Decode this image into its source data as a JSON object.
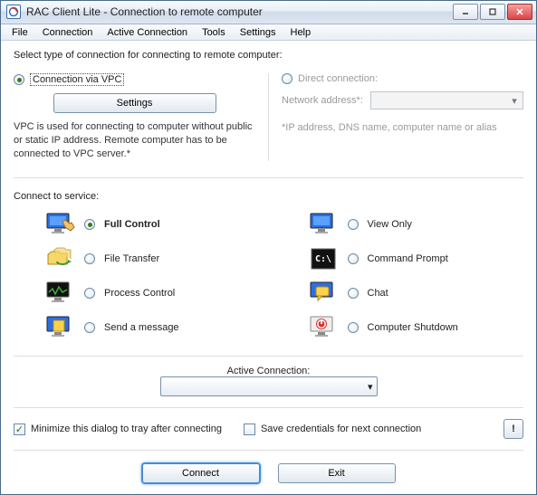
{
  "title": "RAC Client Lite - Connection to remote computer",
  "menu": [
    "File",
    "Connection",
    "Active Connection",
    "Tools",
    "Settings",
    "Help"
  ],
  "prompt": "Select type of connection for connecting to remote computer:",
  "vpc": {
    "radio_label": "Connection via VPC",
    "settings_btn": "Settings",
    "desc": "VPC is used for connecting to computer without public or static IP address. Remote computer has to be connected to VPC server.*"
  },
  "direct": {
    "radio_label": "Direct connection:",
    "addr_label": "Network address*:",
    "hint": "*IP address, DNS name, computer name or alias"
  },
  "svc_header": "Connect to service:",
  "svc": {
    "full": "Full Control",
    "view": "View Only",
    "file": "File Transfer",
    "cmd": "Command Prompt",
    "proc": "Process Control",
    "chat": "Chat",
    "msg": "Send a message",
    "shut": "Computer Shutdown"
  },
  "active_conn_label": "Active Connection:",
  "opts": {
    "minimize": "Minimize this dialog to tray after connecting",
    "savecreds": "Save credentials for next connection"
  },
  "info_btn": "!",
  "buttons": {
    "connect": "Connect",
    "exit": "Exit"
  }
}
